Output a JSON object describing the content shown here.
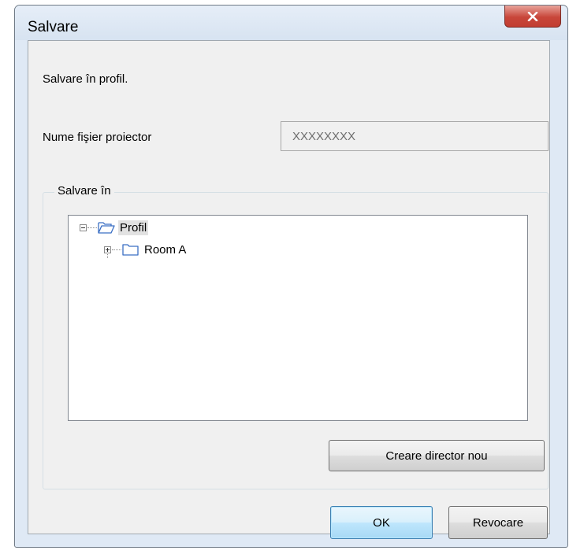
{
  "window": {
    "title": "Salvare"
  },
  "intro_text": "Salvare în profil.",
  "file_field": {
    "label": "Nume fişier proiector",
    "value": "XXXXXXXX"
  },
  "save_in": {
    "legend": "Salvare în",
    "tree": [
      {
        "label": "Profil",
        "expanded": true,
        "selected": true
      },
      {
        "label": "Room A",
        "expanded": false,
        "selected": false
      }
    ],
    "new_folder_button": "Creare director nou"
  },
  "buttons": {
    "ok": "OK",
    "cancel": "Revocare"
  },
  "colors": {
    "close_button": "#c8463a",
    "folder": "#3b6fc4",
    "ok_border": "#3c7fb1"
  },
  "icons": {
    "close": "close-icon",
    "folder_open": "folder-open-icon",
    "folder": "folder-icon"
  }
}
